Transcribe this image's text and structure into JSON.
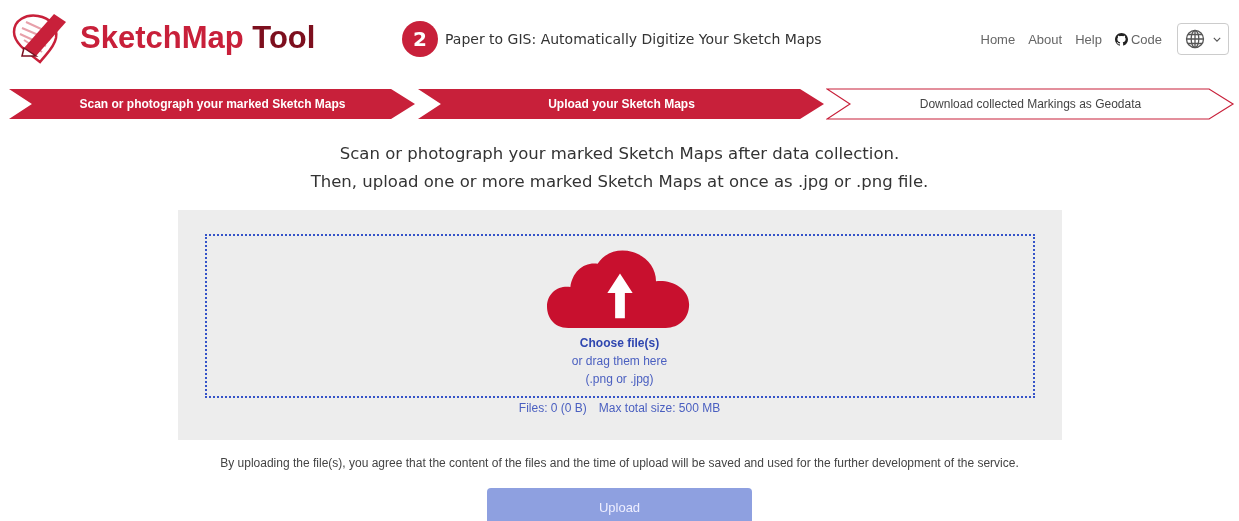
{
  "header": {
    "brand_main": "SketchMap",
    "brand_suffix": "Tool",
    "step_number": "2",
    "step_title": "Paper to GIS: Automatically Digitize Your Sketch Maps",
    "nav": [
      {
        "label": "Home",
        "kind": "link"
      },
      {
        "label": "About",
        "kind": "link"
      },
      {
        "label": "Help",
        "kind": "link"
      },
      {
        "label": "Code",
        "kind": "code"
      }
    ]
  },
  "steps": [
    {
      "label": "Scan or photograph your marked Sketch Maps",
      "filled": true
    },
    {
      "label": "Upload your Sketch Maps",
      "filled": true
    },
    {
      "label": "Download collected Markings as Geodata",
      "filled": false
    }
  ],
  "instructions": [
    "Scan or photograph your marked Sketch Maps after data collection.",
    "Then, upload one or more marked Sketch Maps at once as .jpg or .png file."
  ],
  "dropzone": {
    "choose": "Choose file(s)",
    "drag": "or drag them here",
    "types": "(.png or .jpg)",
    "files": "Files: 0 (0 B)",
    "max_size": "Max total size: 500 MB"
  },
  "disclaimer": "By uploading the file(s), you agree that the content of the files and the time of upload will be saved and used for the further development of the service.",
  "upload_button": {
    "label": "Upload",
    "disabled": true
  }
}
